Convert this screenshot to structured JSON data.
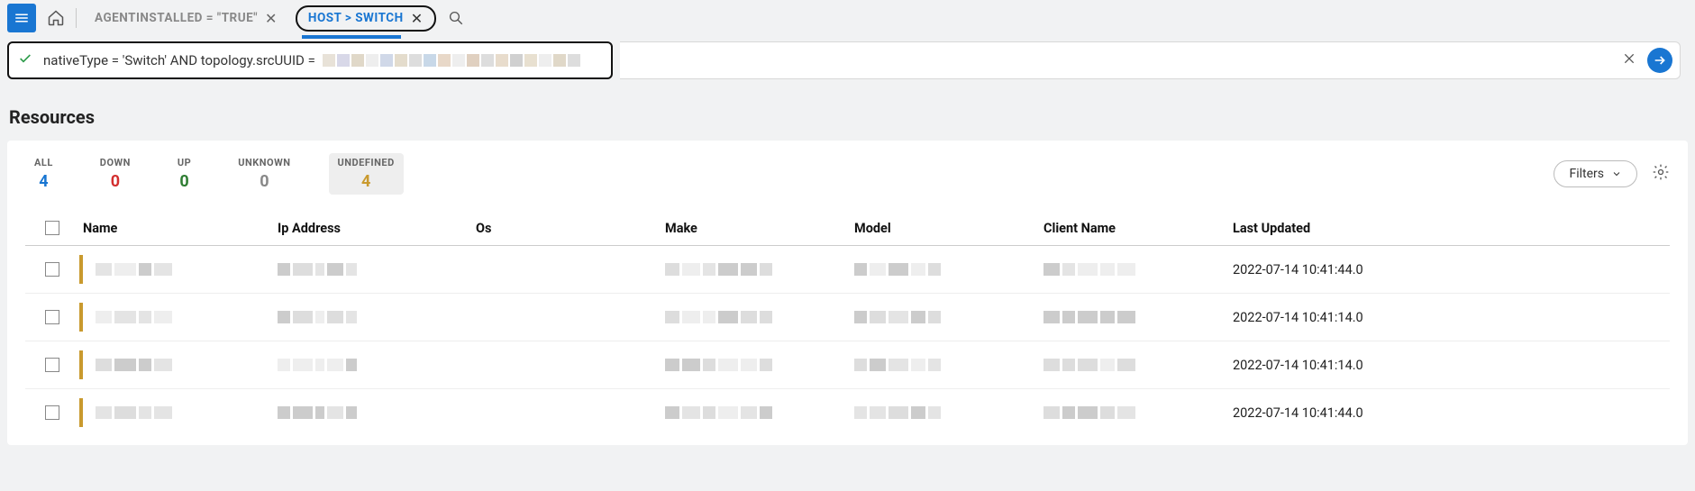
{
  "topbar": {
    "tabs": [
      {
        "label": "AGENTINSTALLED = \"TRUE\"",
        "active": false
      },
      {
        "label": "HOST > SWITCH",
        "active": true
      }
    ]
  },
  "query": {
    "text_prefix": "nativeType = 'Switch' AND topology.srcUUID ="
  },
  "page_title": "Resources",
  "status": [
    {
      "key": "ALL",
      "count": "4",
      "cls": "c-all",
      "selected": false
    },
    {
      "key": "DOWN",
      "count": "0",
      "cls": "c-down",
      "selected": false
    },
    {
      "key": "UP",
      "count": "0",
      "cls": "c-up",
      "selected": false
    },
    {
      "key": "UNKNOWN",
      "count": "0",
      "cls": "c-unk",
      "selected": false
    },
    {
      "key": "UNDEFINED",
      "count": "4",
      "cls": "c-und",
      "selected": true
    }
  ],
  "filters_label": "Filters",
  "columns": [
    "Name",
    "Ip Address",
    "Os",
    "Make",
    "Model",
    "Client Name",
    "Last Updated"
  ],
  "rows": [
    {
      "last_updated": "2022-07-14 10:41:44.0"
    },
    {
      "last_updated": "2022-07-14 10:41:14.0"
    },
    {
      "last_updated": "2022-07-14 10:41:14.0"
    },
    {
      "last_updated": "2022-07-14 10:41:44.0"
    }
  ]
}
